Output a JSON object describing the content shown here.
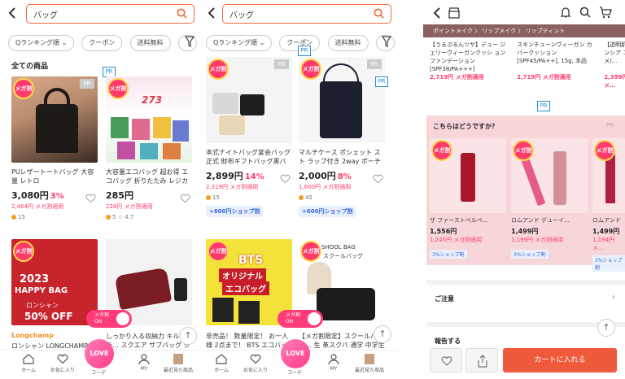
{
  "search": {
    "query": "バッグ"
  },
  "chips": [
    "Qランキング順",
    "クーポン",
    "送料無料"
  ],
  "section_title": "全ての商品",
  "pr": "PR",
  "mega_badge": "メガ割",
  "panel1": {
    "cards": [
      {
        "title": "PUレザートートバッグ 大容量 レトロ",
        "price": "3,080円",
        "pct": "3%",
        "mega_price": "2,464円 メガ割適用",
        "meta": "15",
        "rating": ""
      },
      {
        "title": "大容量エコバッグ 超お得 エコバッグ 折りたたみ レジカゴ…",
        "price": "285円",
        "pct": "",
        "mega_price": "228円 メガ割適用",
        "meta": "5",
        "rating": "4.7"
      },
      {
        "title": "",
        "img_text_1": "2023",
        "img_text_2": "HAPPY BAG",
        "img_text_3": "ロンシャン",
        "img_text_4": "50% OFF"
      },
      {
        "title": "しっかり入る収納力 キルテ… スクエア サブバッグ ショッ…"
      }
    ],
    "brand": "Longchamp",
    "brand_title": "ロンシャン LONGCHAMP …",
    "img_promo": "273"
  },
  "panel2": {
    "cards": [
      {
        "title": "本式ナイトバッグ宴会バッグ正式 財布ギフトバッグ黒バッグ…",
        "price": "2,899円",
        "pct": "14%",
        "mega_price": "2,319円 メガ割適用",
        "meta": "15",
        "shop": "+600円ショップ割"
      },
      {
        "title": "マルチケース ポシェット スト ラップ付き 2way ポーチ 財…",
        "price": "2,000円",
        "pct": "8%",
        "mega_price": "1,600円 メガ割適用",
        "meta": "45",
        "shop": "+600円ショップ割"
      },
      {
        "title": "非売品！ 数量限定！ お一人様 2点まで！ BTS エコバッグ…",
        "img_text_1": "BTS",
        "img_text_2": "オリジナル",
        "img_text_3": "エコバッグ"
      },
      {
        "title": "【メガ割限定】スクールバッ… 生 革スクバ 通学 中学生 高…",
        "img_text_1": "SHOOL BAG",
        "img_text_2": "スクールバッグ"
      }
    ],
    "send_label": "送料無料"
  },
  "toggle": {
    "line1": "メガ割",
    "line2": "ON"
  },
  "nav": {
    "home": "ホーム",
    "fav": "お気に入り",
    "love": "LOVE",
    "coord": "コーデ",
    "my": "MY",
    "recent": "最近見た商品"
  },
  "panel3": {
    "category": "ポイントメイク  〉 リップメイク  〉 リップティント",
    "top_products": [
      {
        "title": "【うるぷるんツヤ】デュー ジェリーヴィーガンクッシ ョンファンデーション [SPF38/PA+++]",
        "mega_price": "2,719円 メガ割適用"
      },
      {
        "title": "スキンチューンヴィーガン カバークッション [SPF45/PA++], 15g, 本品",
        "mega_price": "2,719円 メガ割適用"
      },
      {
        "title": "【透明肌 ガンシア コスメ/…",
        "mega_price": "2,399円 メ…"
      }
    ],
    "reco_title": "こちらはどうですか？",
    "reco_cards": [
      {
        "title": "ザ ファーストベルベ…",
        "price": "1,556円",
        "mega_price": "1,245円 メガ割適用",
        "shop": "3%ショップ割"
      },
      {
        "title": "ロムアンド デューイ…",
        "price": "1,499円",
        "mega_price": "1,199円 メガ割適用",
        "shop": "3%ショップ割"
      },
      {
        "title": "ロムアンド",
        "price": "1,499円",
        "mega_price": "1,194円 メ…",
        "shop": "3%ショップ割"
      }
    ],
    "notice": "ご注意",
    "report": "報告する",
    "cart": "カートに入れる"
  },
  "colors": {
    "accent": "#f06a3c",
    "pink": "#ff3b6b",
    "pr_blue": "#2a8fd6"
  }
}
